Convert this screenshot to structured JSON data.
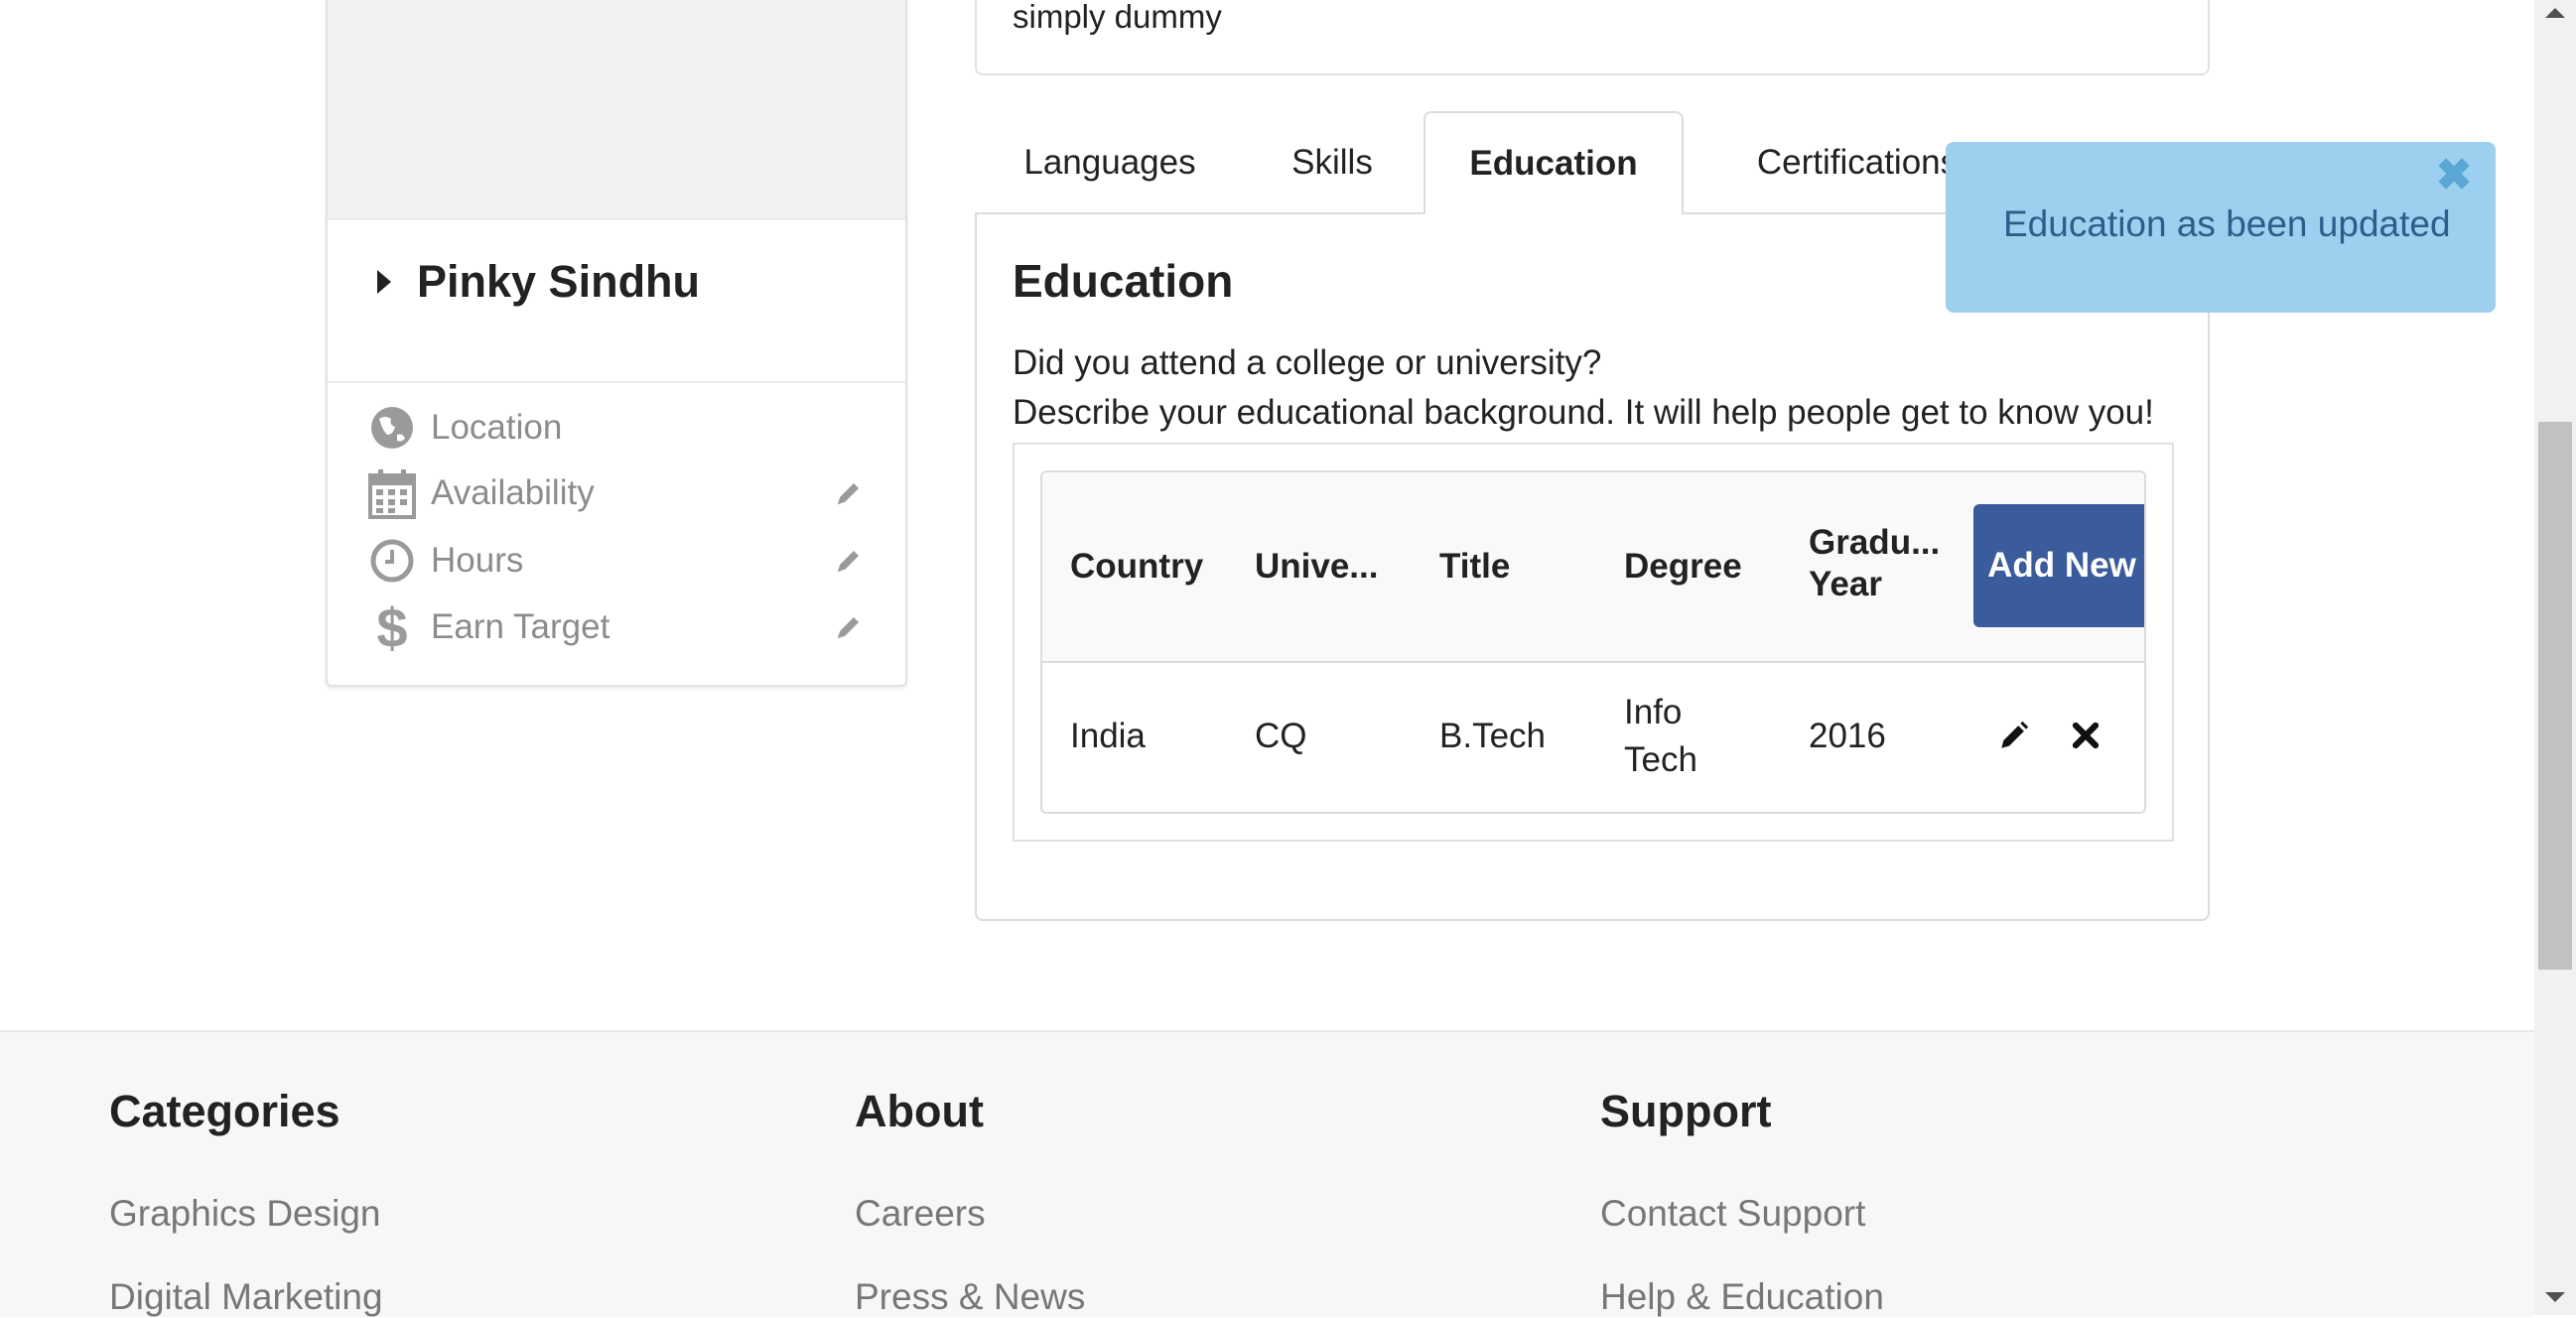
{
  "profile": {
    "name": "Pinky Sindhu",
    "info_items": [
      {
        "icon": "globe-icon",
        "label": "Location",
        "editable": false
      },
      {
        "icon": "calendar-icon",
        "label": "Availability",
        "editable": true
      },
      {
        "icon": "clock-icon",
        "label": "Hours",
        "editable": true
      },
      {
        "icon": "dollar-icon",
        "label": "Earn Target",
        "editable": true
      }
    ]
  },
  "description": {
    "text": "simply dummy"
  },
  "tabs": [
    {
      "label": "Languages",
      "active": false
    },
    {
      "label": "Skills",
      "active": false
    },
    {
      "label": "Education",
      "active": true
    },
    {
      "label": "Certifications",
      "active": false
    }
  ],
  "education": {
    "title": "Education",
    "question": "Did you attend a college or university?",
    "description": "Describe your educational background. It will help people get to know you!",
    "columns": [
      "Country",
      "Unive...",
      "Title",
      "Degree",
      "Gradu... Year"
    ],
    "add_button": "Add New",
    "rows": [
      {
        "country": "India",
        "university": "CQ",
        "title": "B.Tech",
        "degree": "Info Tech",
        "year": "2016"
      }
    ]
  },
  "toast": {
    "message": "Education as been updated",
    "close_glyph": "✖"
  },
  "footer": {
    "columns": [
      {
        "heading": "Categories",
        "links": [
          "Graphics Design",
          "Digital Marketing"
        ]
      },
      {
        "heading": "About",
        "links": [
          "Careers",
          "Press & News"
        ]
      },
      {
        "heading": "Support",
        "links": [
          "Contact Support",
          "Help & Education"
        ]
      }
    ]
  },
  "colors": {
    "accent": "#3a5b9c",
    "toast_bg": "#9dcfee",
    "muted_text": "#8c8c8c"
  }
}
